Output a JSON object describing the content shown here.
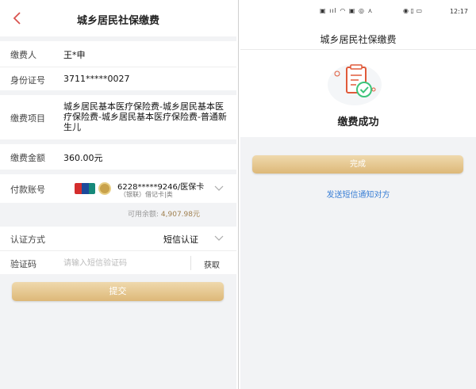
{
  "payment_form": {
    "header": {
      "title": "城乡居民社保缴费"
    },
    "payer": {
      "label": "缴费人",
      "value": "王*申"
    },
    "id_number": {
      "label": "身份证号",
      "value": "3711*****0027"
    },
    "item": {
      "label": "缴费项目",
      "value": "城乡居民基本医疗保险费-城乡居民基本医疗保险费-城乡居民基本医疗保险费-普通新生儿"
    },
    "amount": {
      "label": "缴费金额",
      "value": "360.00元"
    },
    "account": {
      "label": "付款账号",
      "card_number": "6228*****9246/医保卡",
      "card_type": "（银联）借记卡|类",
      "balance_label": "可用余额:",
      "balance_value": "4,907.98元"
    },
    "auth": {
      "label": "认证方式",
      "value": "短信认证"
    },
    "code": {
      "label": "验证码",
      "placeholder": "请输入短信验证码",
      "get_label": "获取"
    },
    "submit_label": "提交"
  },
  "result": {
    "status_bar": {
      "time": "12:17"
    },
    "header": {
      "title": "城乡居民社保缴费"
    },
    "success_text": "缴费成功",
    "done_label": "完成",
    "notify_link": "发送短信通知对方"
  },
  "colors": {
    "gold_button": "#ddb878",
    "link_blue": "#3a7fd5",
    "success_green": "#3cc47a",
    "illustration_red": "#e05a3a"
  }
}
